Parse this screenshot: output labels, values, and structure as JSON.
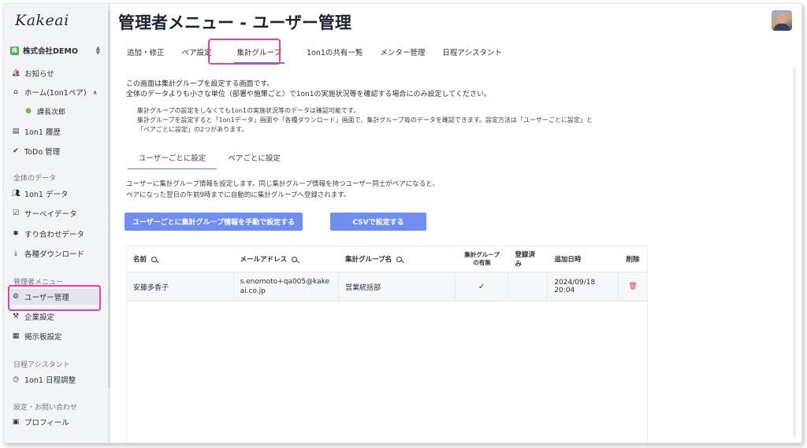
{
  "app": {
    "logo": "Kakeai",
    "company": "株式会社DEMO",
    "company_badge": "株"
  },
  "sidebar": {
    "items": [
      {
        "label": "お知らせ",
        "icon": "bell-icon"
      },
      {
        "label": "ホーム(1on1ペア)",
        "icon": "home-icon"
      },
      {
        "label": "課長次郎",
        "icon": "user-icon"
      },
      {
        "label": "1on1 履歴",
        "icon": "history-icon"
      },
      {
        "label": "ToDo 管理",
        "icon": "check-circle-icon"
      },
      {
        "label": "1on1 データ",
        "icon": "people-icon"
      },
      {
        "label": "サーベイデータ",
        "icon": "survey-icon"
      },
      {
        "label": "すり合わせデータ",
        "icon": "puzzle-icon"
      },
      {
        "label": "各種ダウンロード",
        "icon": "download-icon"
      },
      {
        "label": "ユーザー管理",
        "icon": "user-gear-icon"
      },
      {
        "label": "企業設定",
        "icon": "company-icon"
      },
      {
        "label": "掲示板設定",
        "icon": "board-icon"
      },
      {
        "label": "1on1 日程調整",
        "icon": "clock-icon"
      },
      {
        "label": "プロフィール",
        "icon": "profile-icon"
      }
    ],
    "sections": [
      "全体のデータ",
      "管理者メニュー",
      "日程アシスタント",
      "設定・お問い合わせ"
    ]
  },
  "header": {
    "title": "管理者メニュー - ユーザー管理"
  },
  "tabs": [
    "追加・修正",
    "ペア設定",
    "集計グループ",
    "1on1の共有一覧",
    "メンター管理",
    "日程アシスタント"
  ],
  "main": {
    "desc_line1": "この画面は集計グループを設定する画面です。",
    "desc_line2": "全体のデータよりも小さな単位（部署や施策ごと）で1on1の実施状況等を確認する場合にのみ設定してください。",
    "note_line1": "集計グループの設定をしなくても1on1の実施状況等のデータは確認可能です。",
    "note_line2": "集計グループを設定すると「1on1データ」画面や「各種ダウンロード」画面で、集計グループ毎のデータを確認できます。設定方法は「ユーザーごとに設定」と",
    "note_line3": "「ペアごとに設定」の2つがあります。",
    "subtabs": [
      "ユーザーごとに設定",
      "ペアごとに設定"
    ],
    "desc2_line1": "ユーザーに集計グループ情報を設定します。同じ集計グループ情報を持つユーザー同士がペアになると、",
    "desc2_line2": "ペアになった翌日の午前9時までに自動的に集計グループへ登録されます。",
    "btn_manual": "ユーザーごとに集計グループ情報を手動で設定する",
    "btn_csv": "CSVで設定する"
  },
  "table": {
    "headers": {
      "name": "名前",
      "email": "メールアドレス",
      "group": "集計グループ名",
      "has_group": "集計グループ の有無",
      "registered": "登録済み",
      "added": "追加日時",
      "delete": "削除"
    },
    "rows": [
      {
        "name": "安藤多香子",
        "email": "s.enomoto+qa005@kakeai.co.jp",
        "group": "営業統括部",
        "has_group": "✓",
        "registered": "",
        "added": "2024/09/18 20:04"
      }
    ]
  }
}
